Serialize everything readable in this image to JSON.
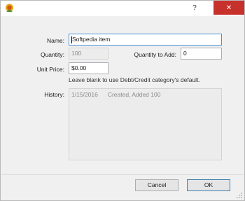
{
  "titlebar": {
    "icon": "app-icon",
    "help_glyph": "?",
    "close_glyph": "✕"
  },
  "form": {
    "name_label": "Name:",
    "name_value": "Softpedia item",
    "quantity_label": "Quantity:",
    "quantity_value": "100",
    "qty_to_add_label": "Quantity to Add:",
    "qty_to_add_value": "0",
    "unit_price_label": "Unit Price:",
    "unit_price_value": "$0.00",
    "unit_price_hint": "Leave blank to use Debt/Credit category's default.",
    "history_label": "History:",
    "history": [
      {
        "date": "1/15/2016",
        "event": "Created, Added 100"
      }
    ]
  },
  "buttons": {
    "cancel_label": "Cancel",
    "ok_label": "OK"
  },
  "colors": {
    "close_button": "#c7312b",
    "focus_border": "#4a90d9"
  }
}
